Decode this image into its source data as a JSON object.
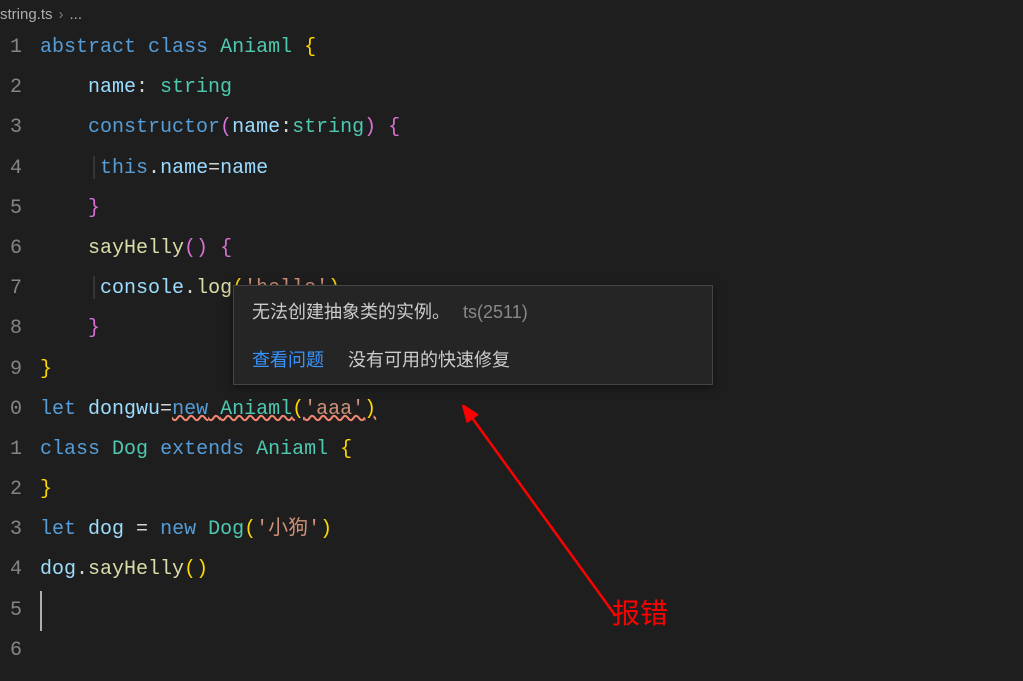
{
  "breadcrumb": {
    "file": "string.ts",
    "rest": "..."
  },
  "gutter": [
    "1",
    "2",
    "3",
    "4",
    "5",
    "6",
    "7",
    "8",
    "9",
    "0",
    "1",
    "2",
    "3",
    "4",
    "5",
    "6"
  ],
  "code": {
    "l1": {
      "kw_abstract": "abstract",
      "kw_class": "class",
      "name": "Aniaml",
      "brace": "{"
    },
    "l2": {
      "prop": "name",
      "colon": ": ",
      "type": "string"
    },
    "l3": {
      "ctor": "constructor",
      "open": "(",
      "param": "name",
      "colon": ":",
      "ptype": "string",
      "close": ")",
      "brace": " {"
    },
    "l4": {
      "this": "this",
      "dot": ".",
      "prop": "name",
      "eq": "=",
      "rhs": "name"
    },
    "l5": {
      "brace": "}"
    },
    "l6": {
      "name": "sayHelly",
      "open": "(",
      "close": ")",
      "brace": " {"
    },
    "l7": {
      "obj": "console",
      "dot": ".",
      "fn": "log",
      "open": "(",
      "str": "'hello'",
      "close": ")"
    },
    "l8": {
      "brace": "}"
    },
    "l9": {
      "brace": "}"
    },
    "l10": {
      "kw_let": "let",
      "var": "dongwu",
      "eq": "=",
      "kw_new": "new",
      "cls": "Aniaml",
      "open": "(",
      "str": "'aaa'",
      "close": ")"
    },
    "l11": {
      "kw_class": "class",
      "name": "Dog",
      "kw_extends": "extends",
      "base": "Aniaml",
      "brace": " {"
    },
    "l12": {
      "brace": "}"
    },
    "l13": {
      "kw_let": "let",
      "var": "dog",
      "eq": " = ",
      "kw_new": "new",
      "cls": "Dog",
      "open": "(",
      "str": "'小狗'",
      "close": ")"
    },
    "l14": {
      "obj": "dog",
      "dot": ".",
      "fn": "sayHelly",
      "open": "(",
      "close": ")"
    }
  },
  "tooltip": {
    "message": "无法创建抽象类的实例。",
    "errcode": "ts(2511)",
    "view_problem": "查看问题",
    "no_quickfix": "没有可用的快速修复"
  },
  "annotation": {
    "text": "报错"
  }
}
